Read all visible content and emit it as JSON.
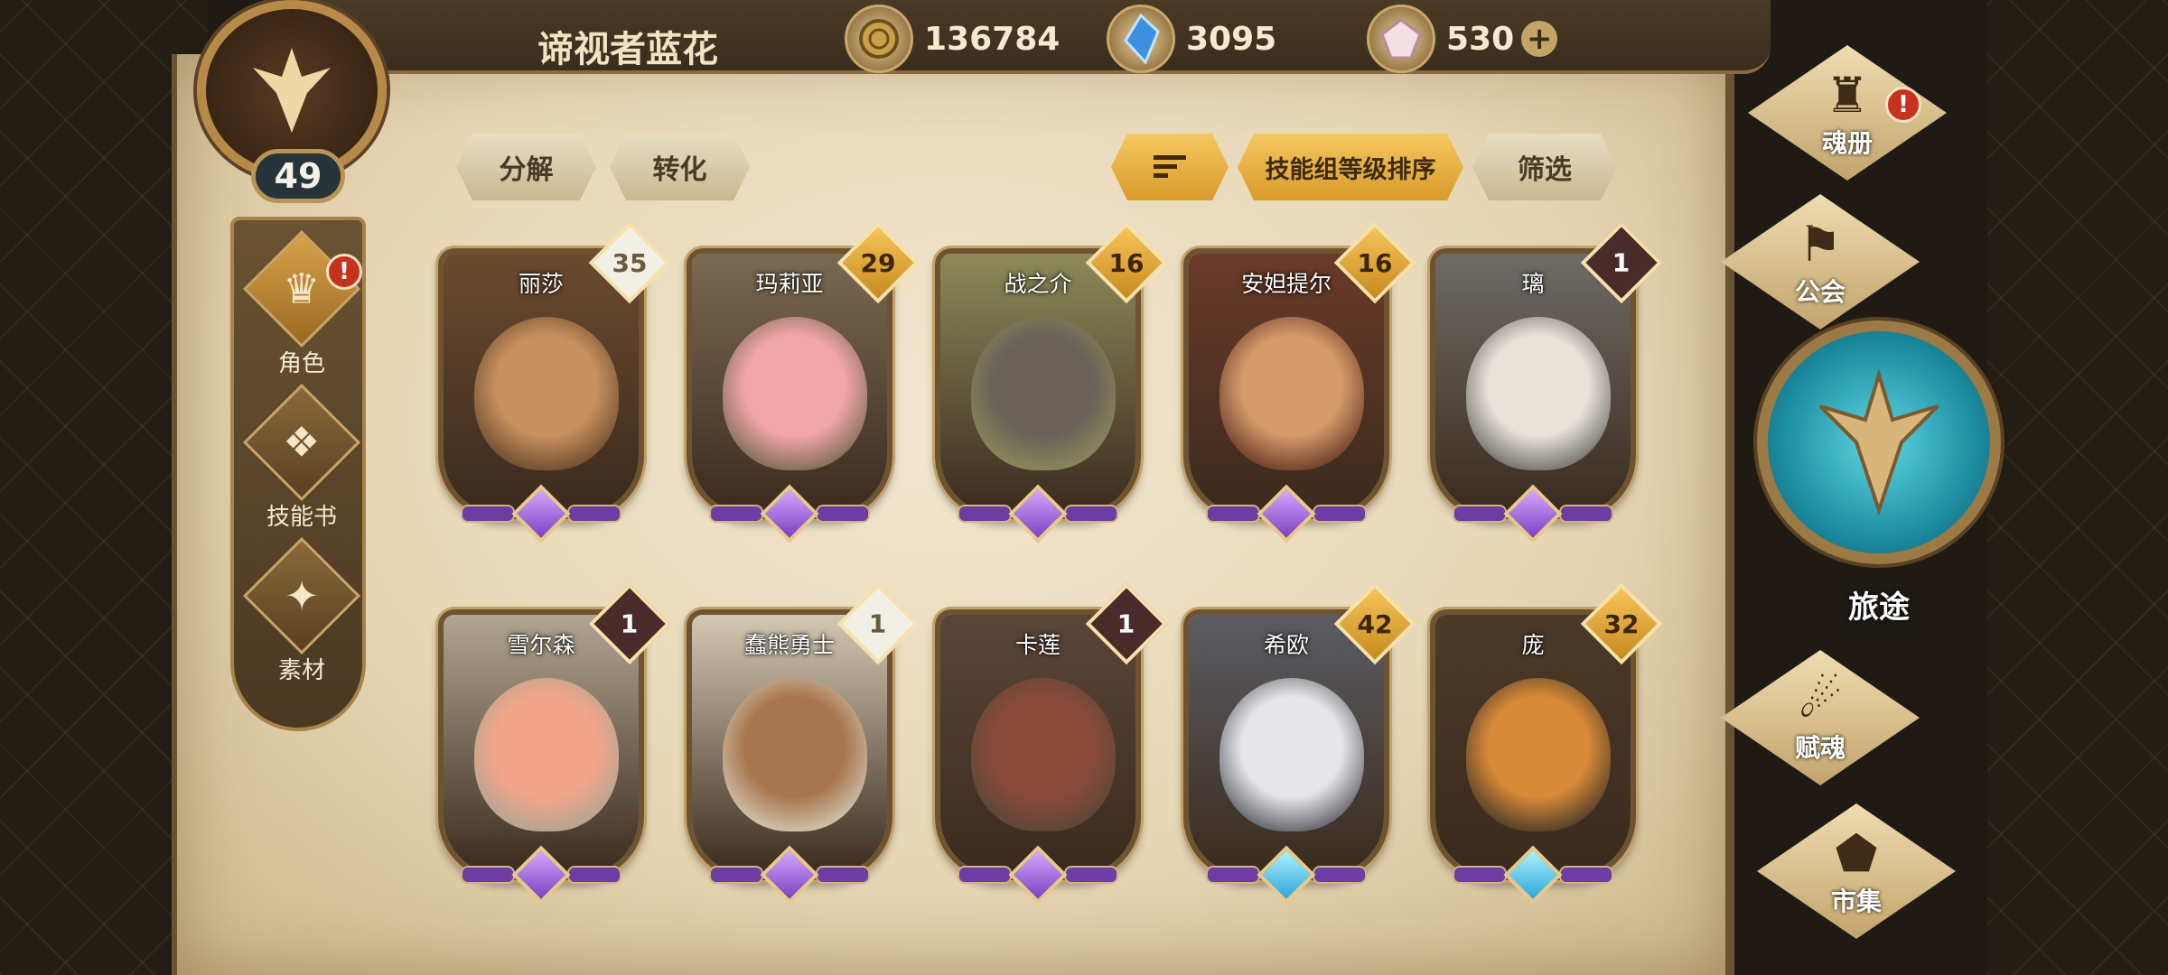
{
  "header": {
    "player_name": "谛视者蓝花",
    "currencies": [
      {
        "icon": "gold-coin-icon",
        "value": "136784"
      },
      {
        "icon": "blue-crystal-icon",
        "value": "3095"
      },
      {
        "icon": "pink-gem-icon",
        "value": "530"
      }
    ],
    "plus": "+"
  },
  "player": {
    "level": "49"
  },
  "left_nav": [
    {
      "label": "角色",
      "icon": "character-icon",
      "active": true,
      "alert": "!"
    },
    {
      "label": "技能书",
      "icon": "skill-book-icon"
    },
    {
      "label": "素材",
      "icon": "materials-icon"
    }
  ],
  "toolbar": {
    "decompose": "分解",
    "convert": "转化",
    "sort_order": "技能组等级排序",
    "filter": "筛选"
  },
  "cards": [
    {
      "name": "丽莎",
      "level": "35",
      "tag": "white",
      "gem": "purple"
    },
    {
      "name": "玛莉亚",
      "level": "29",
      "tag": "gold",
      "gem": "purple"
    },
    {
      "name": "战之介",
      "level": "16",
      "tag": "gold",
      "gem": "purple"
    },
    {
      "name": "安妲提尔",
      "level": "16",
      "tag": "gold",
      "gem": "purple"
    },
    {
      "name": "璃",
      "level": "1",
      "tag": "dark",
      "gem": "purple"
    },
    {
      "name": "雪尔森",
      "level": "1",
      "tag": "dark",
      "gem": "purple"
    },
    {
      "name": "蠢熊勇士",
      "level": "1",
      "tag": "white",
      "gem": "purple"
    },
    {
      "name": "卡莲",
      "level": "1",
      "tag": "dark",
      "gem": "purple"
    },
    {
      "name": "希欧",
      "level": "42",
      "tag": "gold",
      "gem": "blue"
    },
    {
      "name": "庞",
      "level": "32",
      "tag": "gold",
      "gem": "blue"
    }
  ],
  "right_nav": [
    {
      "label": "魂册",
      "icon": "soul-book-icon",
      "alert": "!"
    },
    {
      "label": "公会",
      "icon": "guild-icon"
    },
    {
      "label": "旅途",
      "icon": "journey-icon"
    },
    {
      "label": "赋魂",
      "icon": "soul-infuse-icon"
    },
    {
      "label": "市集",
      "icon": "market-icon"
    }
  ],
  "colors": {
    "parchment": "#e7d7b6",
    "frame": "#6e5330",
    "gold": "#d99a2a",
    "journey": "#1e8fa4"
  }
}
